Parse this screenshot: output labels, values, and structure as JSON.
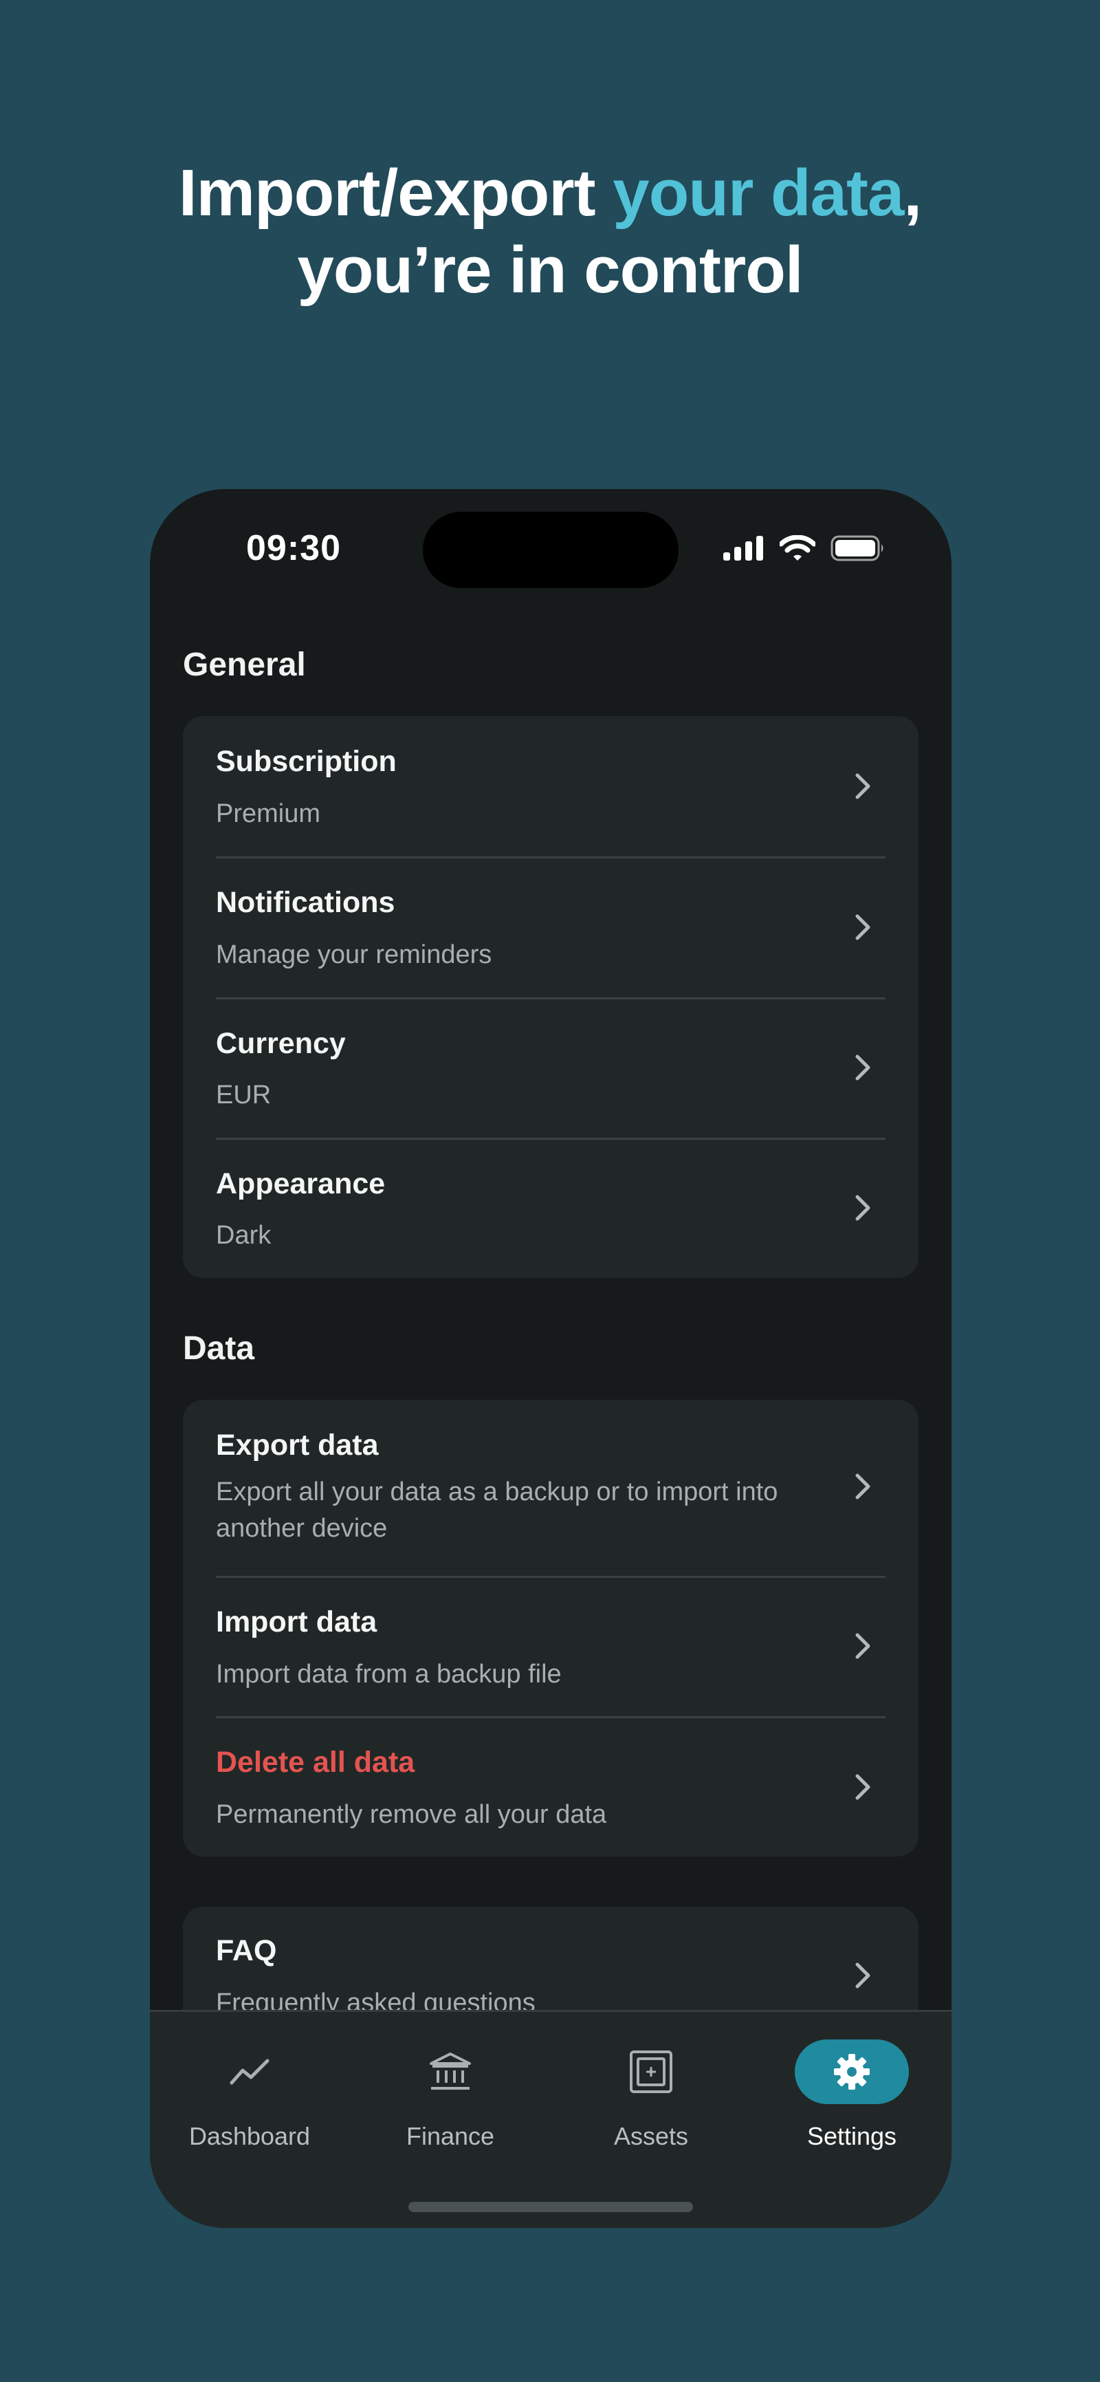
{
  "headline": {
    "line1_start": "Import/export ",
    "line1_highlight": "your data",
    "line1_end": ",",
    "line2": "you’re in control"
  },
  "status_bar": {
    "time": "09:30"
  },
  "sections": {
    "general": {
      "title": "General",
      "items": [
        {
          "title": "Subscription",
          "subtitle": "Premium"
        },
        {
          "title": "Notifications",
          "subtitle": "Manage your reminders"
        },
        {
          "title": "Currency",
          "subtitle": "EUR"
        },
        {
          "title": "Appearance",
          "subtitle": "Dark"
        }
      ]
    },
    "data": {
      "title": "Data",
      "items": [
        {
          "title": "Export data",
          "subtitle": "Export all your data as a backup or to import into another device"
        },
        {
          "title": "Import data",
          "subtitle": "Import data from a backup file"
        },
        {
          "title": "Delete all data",
          "subtitle": "Permanently remove all your data"
        }
      ]
    },
    "help": {
      "items": [
        {
          "title": "FAQ",
          "subtitle": "Frequently asked questions"
        }
      ]
    }
  },
  "tabbar": {
    "tabs": [
      {
        "label": "Dashboard",
        "icon": "trend-line-icon"
      },
      {
        "label": "Finance",
        "icon": "bank-icon"
      },
      {
        "label": "Assets",
        "icon": "safe-icon"
      },
      {
        "label": "Settings",
        "icon": "gear-icon",
        "active": true
      }
    ]
  },
  "colors": {
    "background": "#224a59",
    "highlight": "#52c2d8",
    "phone": "#161a1a",
    "card": "#212727",
    "danger": "#e45450",
    "active_tab": "#208a9e"
  }
}
